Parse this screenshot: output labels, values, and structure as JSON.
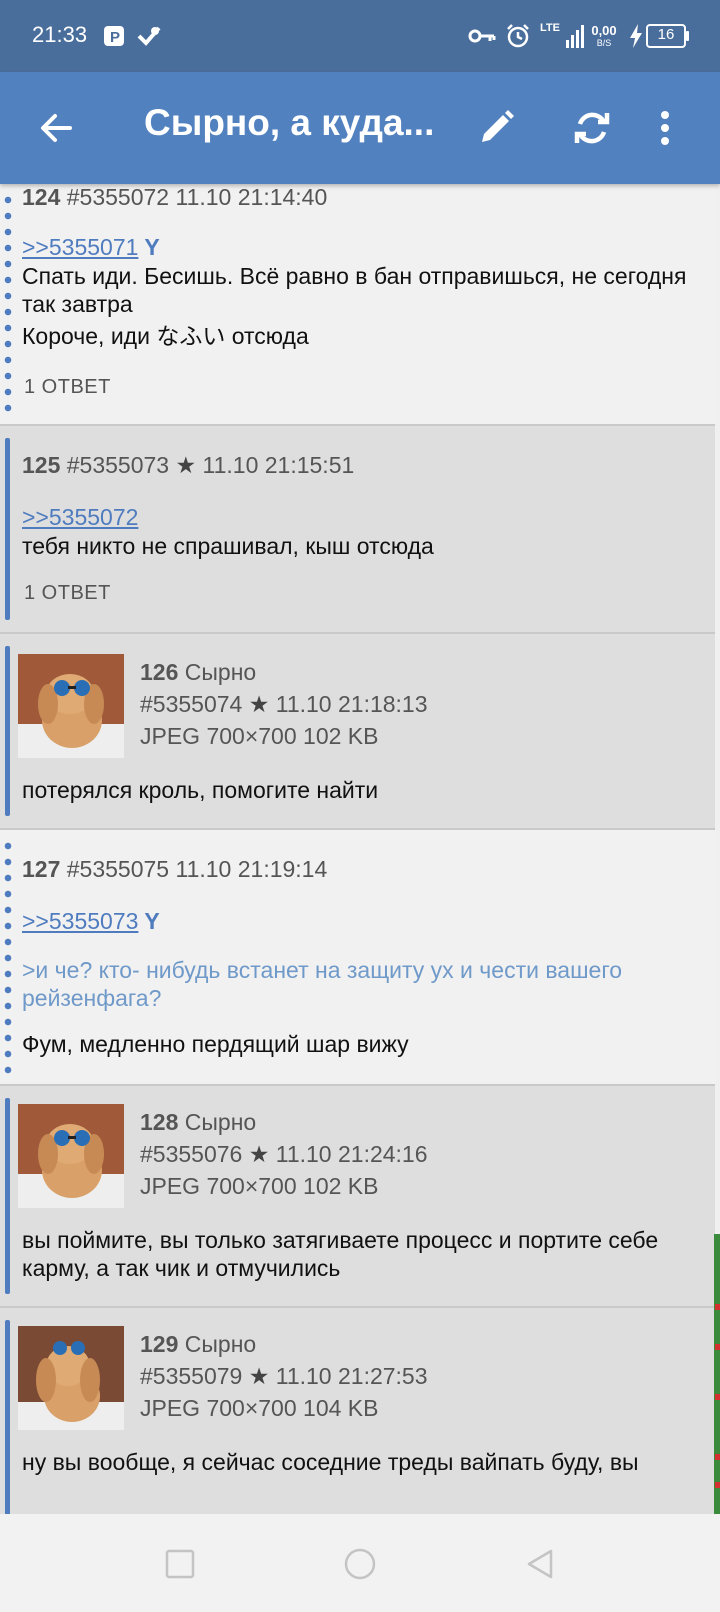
{
  "status_bar": {
    "time": "21:33",
    "network": "LTE",
    "speed_value": "0,00",
    "speed_unit": "B/S",
    "battery": "16"
  },
  "toolbar": {
    "title": "Сырно, а куда..."
  },
  "posts": [
    {
      "number": "124",
      "name": "",
      "id": "#5355072",
      "star": false,
      "date": "11.10 21:14:40",
      "reply_to": ">>5355071",
      "reply_mark": "Y",
      "lines": [
        "Спать иди. Бесишь. Всё равно в бан отправишься, не сегодня так завтра",
        "Короче, иди なふい отсюда"
      ],
      "replies": "1 ОТВЕТ"
    },
    {
      "number": "125",
      "name": "",
      "id": "#5355073",
      "star": true,
      "date": "11.10 21:15:51",
      "reply_to": ">>5355072",
      "reply_mark": "",
      "lines": [
        "тебя никто не спрашивал, кыш отсюда"
      ],
      "replies": "1 ОТВЕТ"
    },
    {
      "number": "126",
      "name": "Сырно",
      "id": "#5355074",
      "star": true,
      "date": "11.10 21:18:13",
      "file_info": "JPEG 700×700 102 KB",
      "lines": [
        "потерялся кроль, помогите найти"
      ]
    },
    {
      "number": "127",
      "name": "",
      "id": "#5355075",
      "star": false,
      "date": "11.10 21:19:14",
      "reply_to": ">>5355073",
      "reply_mark": "Y",
      "quote": ">и че? кто- нибудь встанет на защиту ух и чести вашего рейзенфага?",
      "lines": [
        "Фум, медленно пердящий шар вижу"
      ]
    },
    {
      "number": "128",
      "name": "Сырно",
      "id": "#5355076",
      "star": true,
      "date": "11.10 21:24:16",
      "file_info": "JPEG 700×700 102 KB",
      "lines": [
        "вы поймите, вы только затягиваете процесс и портите себе карму, а так чик и отмучились"
      ]
    },
    {
      "number": "129",
      "name": "Сырно",
      "id": "#5355079",
      "star": true,
      "date": "11.10 21:27:53",
      "file_info": "JPEG 700×700 104 KB",
      "lines": [
        "ну вы вообще, я сейчас соседние треды вайпать буду, вы"
      ]
    }
  ],
  "colors": {
    "status_bar": "#4a6e9c",
    "toolbar": "#5281bf",
    "accent": "#4f7cbf",
    "quote": "#6f99c9"
  },
  "icons": {
    "back": "arrow-left-icon",
    "edit": "pencil-icon",
    "refresh": "refresh-icon",
    "menu": "more-vert-icon"
  }
}
